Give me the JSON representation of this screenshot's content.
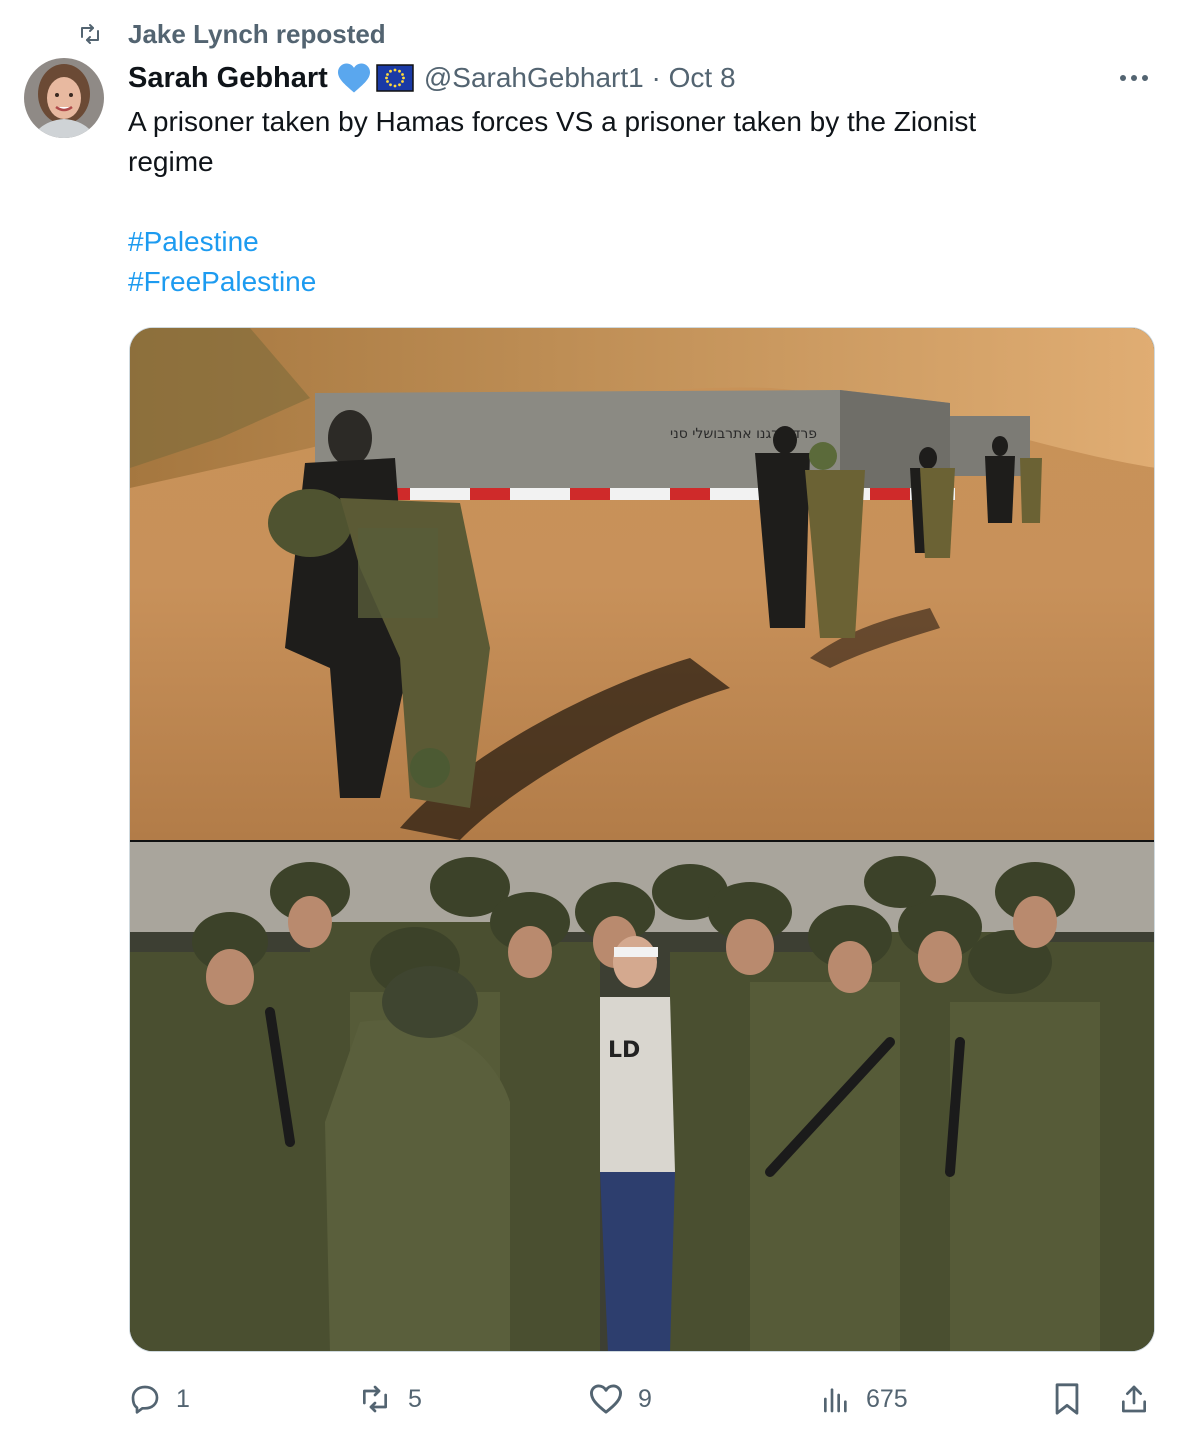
{
  "repost": {
    "icon": "repost-icon",
    "text": "Jake Lynch reposted"
  },
  "tweet": {
    "author": {
      "display_name": "Sarah Gebhart",
      "badges": [
        "blue-heart-icon",
        "eu-flag-icon"
      ],
      "handle_date": "@SarahGebhart1 · Oct 8"
    },
    "text_line1": "A prisoner taken by Hamas forces VS a prisoner taken by the Zionist",
    "text_line2": "regime",
    "hashtags": [
      "#Palestine",
      "#FreePalestine"
    ],
    "media": {
      "top_photo_sign": "פרדס רגנו אתרבושלי סני",
      "bottom_shirt_text": "LD"
    }
  },
  "actions": {
    "reply": {
      "icon": "reply-icon",
      "count": "1"
    },
    "repost": {
      "icon": "repost-icon",
      "count": "5"
    },
    "like": {
      "icon": "heart-icon",
      "count": "9"
    },
    "views": {
      "icon": "views-icon",
      "count": "675"
    },
    "bookmark": {
      "icon": "bookmark-icon"
    },
    "share": {
      "icon": "share-icon"
    }
  },
  "colors": {
    "link": "#1d9bf0",
    "muted": "#536471",
    "text": "#0f1419",
    "border": "#cfd9de"
  }
}
